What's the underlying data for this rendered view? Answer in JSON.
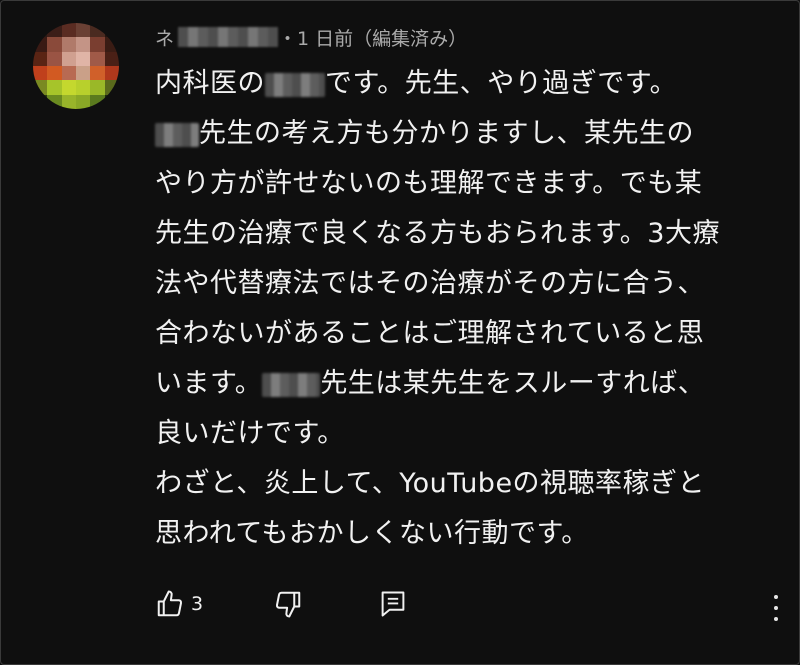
{
  "comment": {
    "author_initial": "ネ",
    "time": "・1 日前（編集済み）",
    "lines": [
      {
        "before": "内科医の",
        "blur": 60,
        "after": "です。先生、やり過ぎです。"
      },
      {
        "before": "",
        "blur": 44,
        "after": "先生の考え方も分かりますし、某先生の"
      },
      {
        "before": "やり方が許せないのも理解できます。でも某",
        "blur": 0,
        "after": ""
      },
      {
        "before": "先生の治療で良くなる方もおられます。3大療",
        "blur": 0,
        "after": ""
      },
      {
        "before": "法や代替療法ではその治療がその方に合う、",
        "blur": 0,
        "after": ""
      },
      {
        "before": "合わないがあることはご理解されていると思",
        "blur": 0,
        "after": ""
      },
      {
        "before": "います。",
        "blur": 58,
        "after": "先生は某先生をスルーすれば、"
      },
      {
        "before": "良いだけです。",
        "blur": 0,
        "after": ""
      },
      {
        "before": "わざと、炎上して、YouTubeの視聴率稼ぎと",
        "blur": 0,
        "after": ""
      },
      {
        "before": "思われてもおかしくない行動です。",
        "blur": 0,
        "after": ""
      }
    ]
  },
  "actions": {
    "like_count": "3",
    "icons": [
      "thumb-up-icon",
      "thumb-down-icon",
      "reply-icon",
      "more-vert-icon"
    ]
  }
}
